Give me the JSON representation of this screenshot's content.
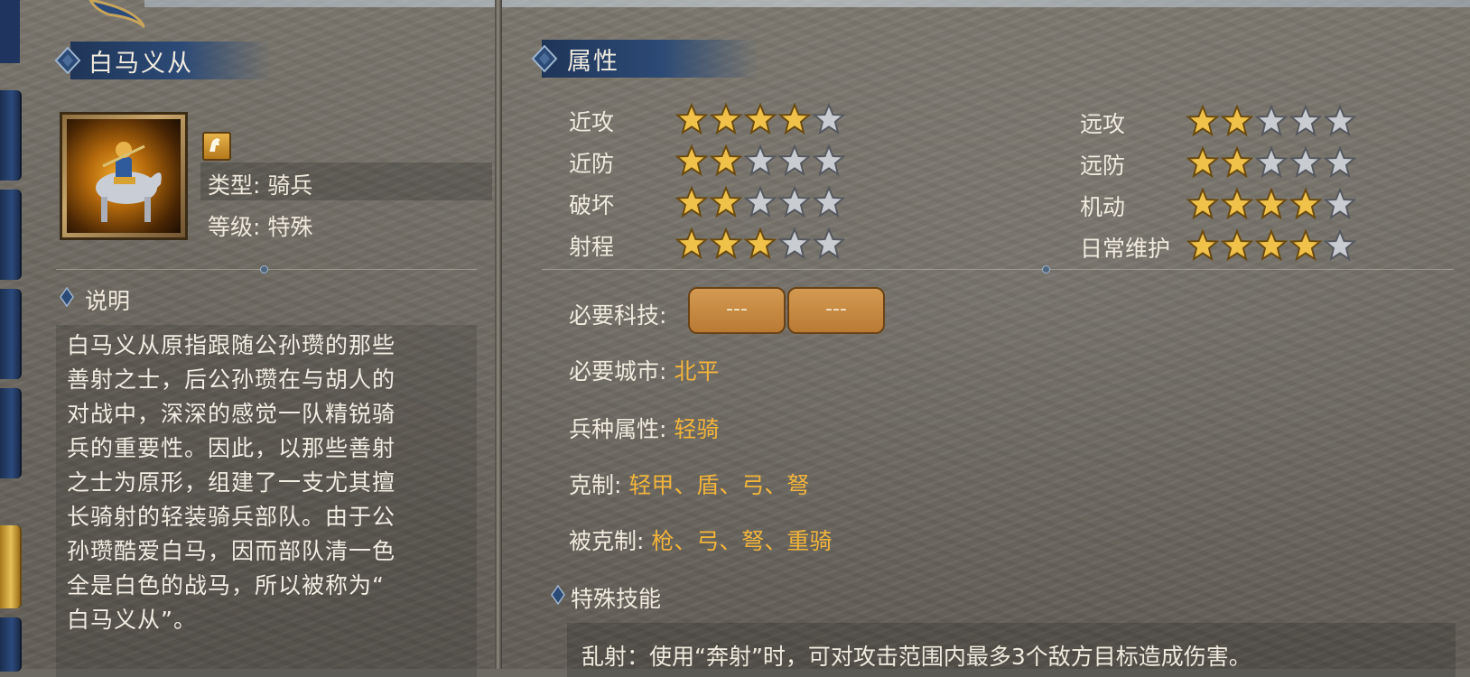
{
  "unit": {
    "name": "白马义从",
    "type_label": "类型: 骑兵",
    "grade_label": "等级: 特殊",
    "portrait_icon": "cavalry-portrait",
    "badge_icon": "horse-icon"
  },
  "description": {
    "heading": "说明",
    "text": "白马义从原指跟随公孙瓒的那些\n善射之士，后公孙瓒在与胡人的\n对战中，深深的感觉一队精锐骑\n兵的重要性。因此，以那些善射\n之士为原形，组建了一支尤其擅\n长骑射的轻装骑兵部队。由于公\n孙瓒酷爱白马，因而部队清一色\n全是白色的战马，所以被称为“\n白马义从”。"
  },
  "attributes": {
    "heading": "属性",
    "max_stars": 5,
    "left": [
      {
        "label": "近攻",
        "value": 4
      },
      {
        "label": "近防",
        "value": 2
      },
      {
        "label": "破坏",
        "value": 2
      },
      {
        "label": "射程",
        "value": 3
      }
    ],
    "right": [
      {
        "label": "远攻",
        "value": 2
      },
      {
        "label": "远防",
        "value": 2
      },
      {
        "label": "机动",
        "value": 4
      },
      {
        "label": "日常维护",
        "value": 4
      }
    ]
  },
  "requirements": {
    "tech_label": "必要科技:",
    "tech_slots": [
      "---",
      "---"
    ],
    "city_label": "必要城市:",
    "city_value": "北平",
    "class_label": "兵种属性:",
    "class_value": "轻骑",
    "counters_label": "克制:",
    "counters_value": "轻甲、盾、弓、弩",
    "countered_by_label": "被克制:",
    "countered_by_value": "枪、弓、弩、重骑"
  },
  "special_skills": {
    "heading": "特殊技能",
    "text": "乱射：使用“奔射”时，可对攻击范围内最多3个敌方目标造成伤害。"
  },
  "colors": {
    "header_blue": "#2c4a76",
    "highlight_gold": "#f2b43a",
    "star_gold": "#f0c24a",
    "star_empty": "#c9ccd1"
  }
}
